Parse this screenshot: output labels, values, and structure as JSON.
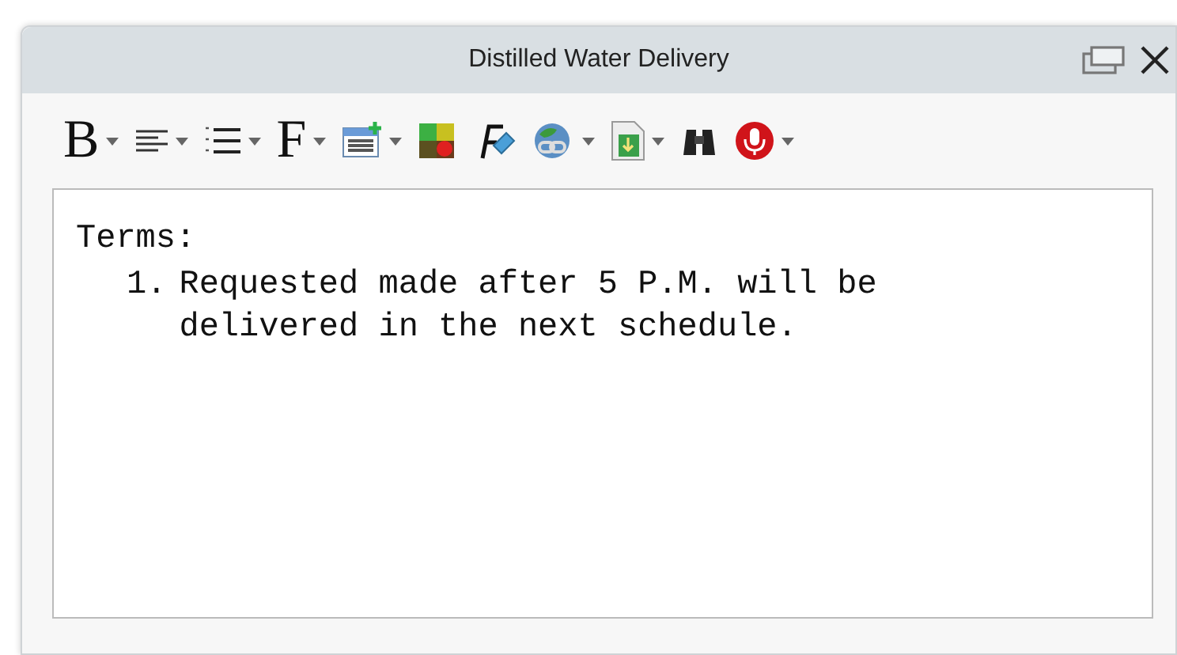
{
  "window": {
    "title": "Distilled Water Delivery"
  },
  "toolbar": [
    {
      "kind": "glyph",
      "text": "B",
      "dropdown": true
    },
    {
      "kind": "align",
      "dropdown": true
    },
    {
      "kind": "list",
      "dropdown": true
    },
    {
      "kind": "glyph",
      "text": "F",
      "dropdown": true
    },
    {
      "kind": "table",
      "dropdown": true
    },
    {
      "kind": "palette",
      "dropdown": false
    },
    {
      "kind": "eraser",
      "dropdown": false
    },
    {
      "kind": "link",
      "dropdown": true
    },
    {
      "kind": "document",
      "dropdown": true
    },
    {
      "kind": "binoculars",
      "dropdown": false
    },
    {
      "kind": "microphone",
      "dropdown": true
    }
  ],
  "editor": {
    "heading": "Terms:",
    "items": [
      {
        "number": "1.",
        "text": "Requested made after 5 P.M. will be delivered in the next schedule."
      }
    ]
  }
}
